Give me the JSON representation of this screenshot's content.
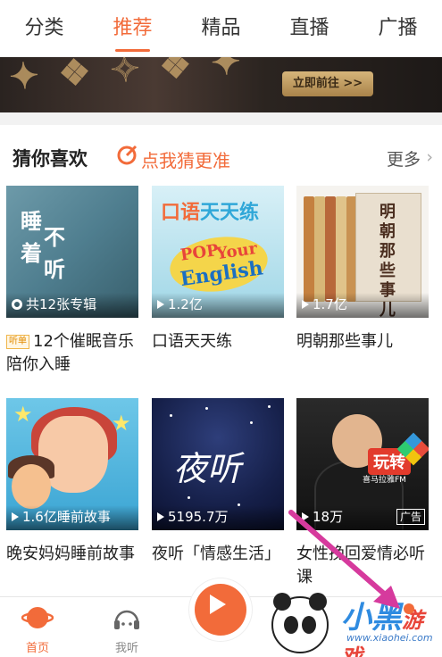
{
  "tabs": [
    {
      "label": "分类",
      "active": false
    },
    {
      "label": "推荐",
      "active": true
    },
    {
      "label": "精品",
      "active": false
    },
    {
      "label": "直播",
      "active": false
    },
    {
      "label": "广播",
      "active": false
    }
  ],
  "banner": {
    "button_label": "立即前往 >>"
  },
  "section": {
    "title": "猜你喜欢",
    "guess_label": "点我猜更准",
    "more_label": "更多",
    "more_chevron": "›"
  },
  "cards": [
    {
      "thumb_text1": "睡",
      "thumb_text2": "着",
      "thumb_text3": "不",
      "thumb_text4": "听",
      "stat": "共12张专辑",
      "stat_icon": "album-icon",
      "tag": "听单",
      "title": "12个催眠音乐陪你入睡"
    },
    {
      "thumb_head1": "口语",
      "thumb_head2": "天天练",
      "pop_text1": "POP",
      "pop_text2": "Your",
      "pop_text3": "English",
      "stat": "1.2亿",
      "stat_icon": "play-icon",
      "title": "口语天天练"
    },
    {
      "cover_text": "明朝那些事儿",
      "stat": "1.7亿",
      "stat_icon": "play-icon",
      "title": "明朝那些事儿"
    },
    {
      "stat": "1.6亿睡前故事",
      "stat_icon": "play-icon",
      "title": "晚安妈妈睡前故事"
    },
    {
      "thumb_text": "夜听",
      "stat": "5195.7万",
      "stat_icon": "play-icon",
      "title": "夜听「情感生活」"
    },
    {
      "badge_text": "玩转",
      "badge_sub": "喜马拉雅FM",
      "stat": "18万",
      "stat_icon": "play-icon",
      "ad_label": "广告",
      "title": "女性挽回爱情必听课"
    }
  ],
  "bottom_nav": [
    {
      "label": "首页",
      "icon": "home-icon",
      "active": true
    },
    {
      "label": "我听",
      "icon": "headphones-icon",
      "active": false
    }
  ],
  "watermark": {
    "text": "小黑",
    "sub": "游戏",
    "url": "www.xiaohei.com"
  },
  "colors": {
    "accent": "#f26b3a",
    "arrow": "#d63a9d"
  }
}
